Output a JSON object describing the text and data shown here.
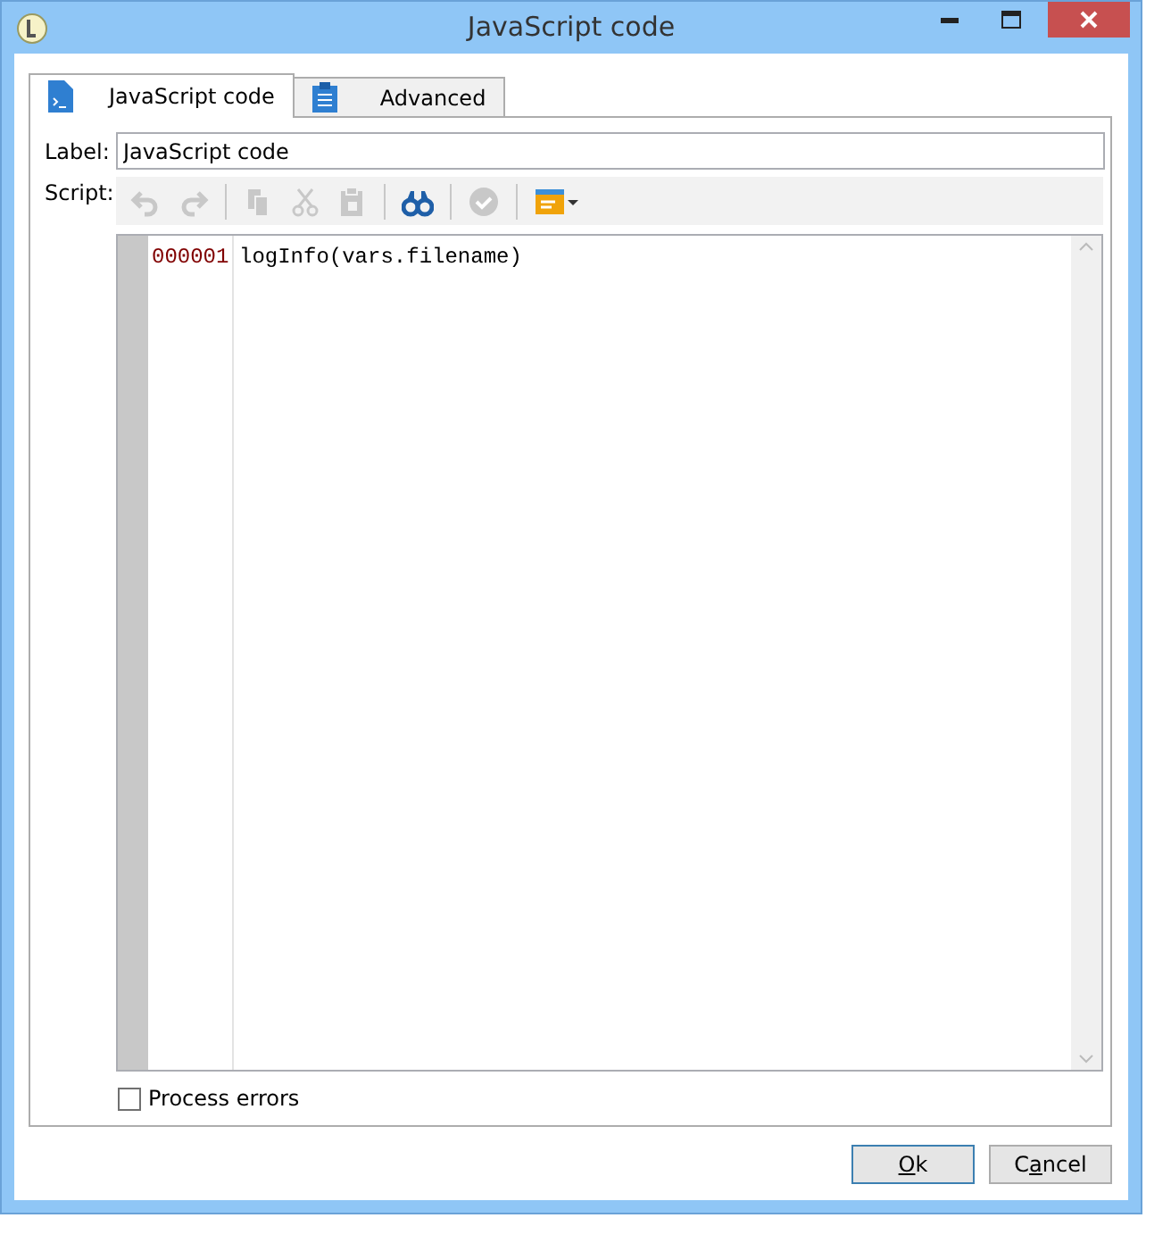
{
  "window": {
    "title": "JavaScript code"
  },
  "tabs": [
    {
      "label": "JavaScript code",
      "selected": true,
      "kind": "script"
    },
    {
      "label": "Advanced",
      "selected": false,
      "kind": "clipboard"
    }
  ],
  "label_field": {
    "label": "Label:",
    "value": "JavaScript code"
  },
  "script": {
    "label": "Script:",
    "toolbar": [
      {
        "kind": "undo",
        "disabled": true
      },
      {
        "kind": "redo",
        "disabled": true
      },
      {
        "kind": "sep"
      },
      {
        "kind": "copy",
        "disabled": true
      },
      {
        "kind": "cut",
        "disabled": true
      },
      {
        "kind": "paste",
        "disabled": true
      },
      {
        "kind": "sep"
      },
      {
        "kind": "find",
        "disabled": false
      },
      {
        "kind": "sep"
      },
      {
        "kind": "check",
        "disabled": true
      },
      {
        "kind": "sep"
      },
      {
        "kind": "insert",
        "disabled": false
      }
    ],
    "lines": [
      {
        "number": "000001",
        "code": "logInfo(vars.filename)"
      }
    ]
  },
  "process_errors": {
    "label": "Process errors",
    "checked": false
  },
  "buttons": [
    {
      "key": "O",
      "after": "k",
      "default": true
    },
    {
      "before": "C",
      "key": "a",
      "after": "ncel",
      "default": false
    }
  ]
}
